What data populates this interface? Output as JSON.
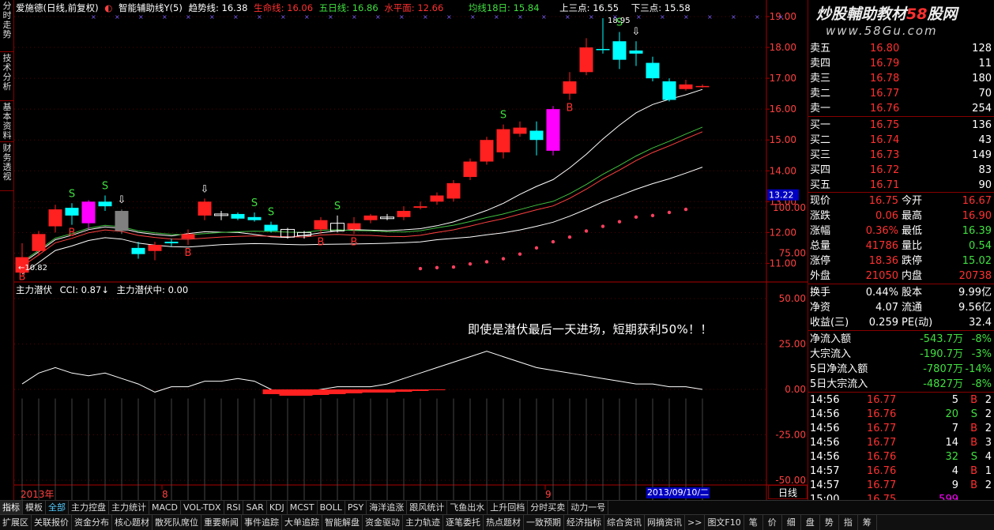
{
  "left_tabs": [
    "分时走势",
    "技术分析",
    "基本资料",
    "财务透视"
  ],
  "title": {
    "stock": "爱施德(日线,前复权)",
    "indicator": "智能辅助线Y(5)",
    "trend": "趋势线: 16.38",
    "life": "生命线: 16.06",
    "five": "五日线: 16.86",
    "water": "水平面: 12.66",
    "ma18": "均线18日: 15.84",
    "upper": "上三点: 16.55",
    "lower": "下三点: 15.58"
  },
  "subtitle": {
    "name": "主力潜伏",
    "cci": "CCI: 0.87↓",
    "mid": "主力潜伏中: 0.00"
  },
  "annotation": "即使是潜伏最后一天进场，短期获利50%！！",
  "watermark": {
    "cn": "炒股輔助教材",
    "num": "58",
    "suffix": "股网",
    "url": "www.58Gu.com"
  },
  "price_axis": [
    "19.00",
    "18.00",
    "17.00",
    "16.00",
    "15.00",
    "14.00",
    "13.00",
    "12.00",
    "11.00"
  ],
  "price_tag": "13.22",
  "osc_axis": [
    "100.00",
    "75.00",
    "50.00",
    "25.00",
    "0.00",
    "-25.00",
    "-50.00"
  ],
  "low_label": "←10.82",
  "high_label": "18.95",
  "x_labels": {
    "year": "2013年",
    "m8": "8",
    "m9": "9"
  },
  "date_label": "2013/09/10/二",
  "day_button": "日线",
  "chart_data": {
    "type": "candlestick",
    "candles": [
      [
        10.7,
        11.2,
        10.82,
        11.65,
        "r"
      ],
      [
        11.4,
        11.95,
        11.25,
        12.05,
        "r"
      ],
      [
        12.2,
        12.75,
        12.0,
        12.9,
        "r"
      ],
      [
        12.8,
        12.55,
        12.25,
        12.95,
        "c"
      ],
      [
        12.3,
        13.0,
        12.1,
        13.05,
        "m"
      ],
      [
        13.0,
        12.85,
        12.7,
        13.2,
        "c"
      ],
      [
        12.7,
        12.05,
        11.95,
        12.75,
        "g"
      ],
      [
        11.5,
        11.3,
        11.15,
        11.7,
        "c"
      ],
      [
        11.4,
        11.6,
        11.1,
        11.7,
        "r"
      ],
      [
        11.7,
        11.65,
        11.55,
        11.8,
        "c"
      ],
      [
        11.8,
        11.95,
        11.6,
        12.1,
        "r"
      ],
      [
        13.0,
        12.55,
        12.4,
        13.1,
        "r"
      ],
      [
        12.55,
        12.6,
        12.4,
        12.7,
        "w"
      ],
      [
        12.6,
        12.45,
        12.4,
        12.65,
        "c"
      ],
      [
        12.5,
        12.4,
        12.35,
        12.65,
        "c"
      ],
      [
        12.25,
        12.05,
        12.0,
        12.35,
        "c"
      ],
      [
        12.1,
        11.85,
        11.8,
        12.15,
        "w"
      ],
      [
        11.9,
        12.0,
        11.8,
        12.05,
        "w"
      ],
      [
        12.1,
        12.4,
        11.95,
        12.5,
        "r"
      ],
      [
        12.05,
        12.3,
        12.0,
        12.55,
        "w"
      ],
      [
        12.1,
        12.3,
        11.95,
        12.5,
        "r"
      ],
      [
        12.55,
        12.4,
        12.3,
        12.6,
        "r"
      ],
      [
        12.5,
        12.45,
        12.4,
        12.6,
        "w"
      ],
      [
        12.5,
        12.7,
        12.4,
        12.85,
        "r"
      ],
      [
        12.85,
        12.8,
        12.75,
        13.0,
        "r"
      ],
      [
        13.2,
        13.0,
        12.9,
        13.3,
        "r"
      ],
      [
        13.6,
        13.1,
        13.0,
        13.7,
        "r"
      ],
      [
        14.3,
        13.8,
        13.7,
        14.4,
        "r"
      ],
      [
        15.0,
        14.3,
        14.2,
        15.1,
        "r"
      ],
      [
        15.35,
        14.6,
        14.4,
        15.5,
        "r"
      ],
      [
        15.4,
        15.2,
        15.1,
        15.6,
        "r"
      ],
      [
        15.3,
        15.0,
        14.5,
        15.6,
        "c"
      ],
      [
        16.0,
        14.65,
        14.5,
        16.1,
        "m"
      ],
      [
        16.9,
        16.5,
        16.3,
        17.2,
        "r"
      ],
      [
        18.0,
        17.2,
        17.1,
        18.3,
        "r"
      ],
      [
        17.95,
        17.95,
        17.8,
        18.95,
        "c"
      ],
      [
        18.2,
        17.6,
        17.3,
        18.5,
        "c"
      ],
      [
        17.9,
        17.8,
        17.4,
        18.2,
        "c"
      ],
      [
        17.5,
        17.0,
        16.9,
        17.7,
        "c"
      ],
      [
        16.9,
        16.3,
        16.25,
        17.0,
        "c"
      ],
      [
        16.8,
        16.65,
        16.6,
        16.95,
        "r"
      ],
      [
        16.75,
        16.75,
        16.7,
        16.8,
        "r"
      ]
    ],
    "osc_bars": [
      0,
      0,
      0,
      0,
      0,
      0,
      0,
      0,
      0,
      0,
      0,
      0,
      0,
      0,
      0,
      -6,
      -8,
      -8,
      -7,
      -6,
      -5,
      -4,
      -4,
      -3,
      -2,
      -1,
      0,
      0,
      0,
      0,
      0,
      0,
      0,
      0,
      0,
      0,
      0,
      0,
      0,
      0,
      0,
      0
    ]
  },
  "quote": {
    "asks": [
      {
        "l": "卖五",
        "p": "16.80",
        "v": "128"
      },
      {
        "l": "卖四",
        "p": "16.79",
        "v": "11"
      },
      {
        "l": "卖三",
        "p": "16.78",
        "v": "180"
      },
      {
        "l": "卖二",
        "p": "16.77",
        "v": "70"
      },
      {
        "l": "卖一",
        "p": "16.76",
        "v": "254"
      }
    ],
    "bids": [
      {
        "l": "买一",
        "p": "16.75",
        "v": "136"
      },
      {
        "l": "买二",
        "p": "16.74",
        "v": "43"
      },
      {
        "l": "买三",
        "p": "16.73",
        "v": "149"
      },
      {
        "l": "买四",
        "p": "16.72",
        "v": "83"
      },
      {
        "l": "买五",
        "p": "16.71",
        "v": "90"
      }
    ],
    "stats": [
      {
        "l1": "现价",
        "v1": "16.75",
        "l2": "今开",
        "v2": "16.67"
      },
      {
        "l1": "涨跌",
        "v1": "0.06",
        "l2": "最高",
        "v2": "16.90"
      },
      {
        "l1": "涨幅",
        "v1": "0.36%",
        "l2": "最低",
        "v2": "16.39"
      },
      {
        "l1": "总量",
        "v1": "41786",
        "l2": "量比",
        "v2": "0.54"
      },
      {
        "l1": "涨停",
        "v1": "18.36",
        "l2": "跌停",
        "v2": "15.02"
      },
      {
        "l1": "外盘",
        "v1": "21050",
        "l2": "内盘",
        "v2": "20738"
      }
    ],
    "stats2": [
      {
        "l1": "换手",
        "v1": "0.44%",
        "l2": "股本",
        "v2": "9.99亿"
      },
      {
        "l1": "净资",
        "v1": "4.07",
        "l2": "流通",
        "v2": "9.56亿"
      },
      {
        "l1": "收益(三)",
        "v1": "0.259",
        "l2": "PE(动)",
        "v2": "32.4"
      }
    ],
    "flows": [
      {
        "l": "净流入额",
        "v": "-543.7万",
        "p": "-8%"
      },
      {
        "l": "大宗流入",
        "v": "-190.7万",
        "p": "-3%"
      },
      {
        "l": "5日净流入额",
        "v": "-7807万",
        "p": "-14%"
      },
      {
        "l": "5日大宗流入",
        "v": "-4827万",
        "p": "-8%"
      }
    ],
    "ticks": [
      {
        "t": "14:56",
        "p": "16.77",
        "v": "5",
        "s": "B",
        "n": "2"
      },
      {
        "t": "14:56",
        "p": "16.76",
        "v": "20",
        "s": "S",
        "n": "2"
      },
      {
        "t": "14:56",
        "p": "16.77",
        "v": "7",
        "s": "B",
        "n": "2"
      },
      {
        "t": "14:56",
        "p": "16.77",
        "v": "14",
        "s": "B",
        "n": "3"
      },
      {
        "t": "14:56",
        "p": "16.76",
        "v": "32",
        "s": "S",
        "n": "4"
      },
      {
        "t": "14:57",
        "p": "16.76",
        "v": "4",
        "s": "B",
        "n": "1"
      },
      {
        "t": "14:57",
        "p": "16.77",
        "v": "9",
        "s": "B",
        "n": "2"
      },
      {
        "t": "15:00",
        "p": "16.75",
        "v": "599",
        "s": "",
        "n": ""
      }
    ]
  },
  "bottom_row1": [
    "指标",
    "模板",
    "全部",
    "主力控盘",
    "主力统计",
    "MACD",
    "VOL-TDX",
    "RSI",
    "SAR",
    "KDJ",
    "MCST",
    "BOLL",
    "PSY",
    "海洋追涨",
    "跟风统计",
    "飞鱼出水",
    "上升回档",
    "分时买卖",
    "动力一号"
  ],
  "bottom_row2": [
    "扩展区",
    "关联报价",
    "资金分布",
    "核心题材",
    "散死队席位",
    "重要新闻",
    "事件追踪",
    "大单追踪",
    "智能解盘",
    "资金驱动",
    "主力轨迹",
    "逐笔委托",
    "热点题材",
    "一致预期",
    "经济指标",
    "综合资讯",
    "网摘资讯",
    ">>",
    "图文F10",
    "笔",
    "价",
    "细",
    "盘",
    "势",
    "指",
    "筹"
  ]
}
